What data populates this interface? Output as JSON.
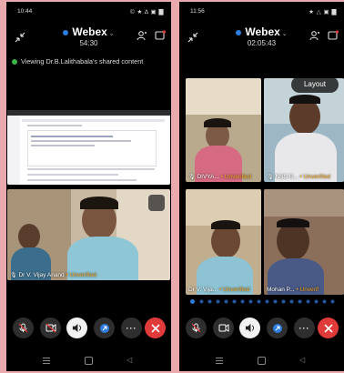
{
  "left": {
    "status_time": "10:44",
    "status_icons": "© ★ Δ ▣ ▇",
    "app_name": "Webex",
    "timer": "54:30",
    "share_text": "Viewing Dr.B.Lalithabala's shared content",
    "participant": {
      "name": "Dr V. Vijay Anand",
      "status": "• Unverified"
    }
  },
  "right": {
    "status_time": "11:56",
    "status_icons": "★ △ ▣ ▇",
    "app_name": "Webex",
    "timer": "02:05:43",
    "layout_button": "Layout",
    "tiles": [
      {
        "name": "DIVYA...",
        "status": "Unverified"
      },
      {
        "name": "NSS R...",
        "status": "Unverified"
      },
      {
        "name": "Dr V. Vija...",
        "status": "Unverified"
      },
      {
        "name": "Mohan P...",
        "status": "Unverif"
      }
    ]
  },
  "colors": {
    "accent_orange": "#f5a623",
    "end_call": "#e03a3a",
    "webex_blue": "#2f7de1",
    "share_green": "#39b54a"
  }
}
